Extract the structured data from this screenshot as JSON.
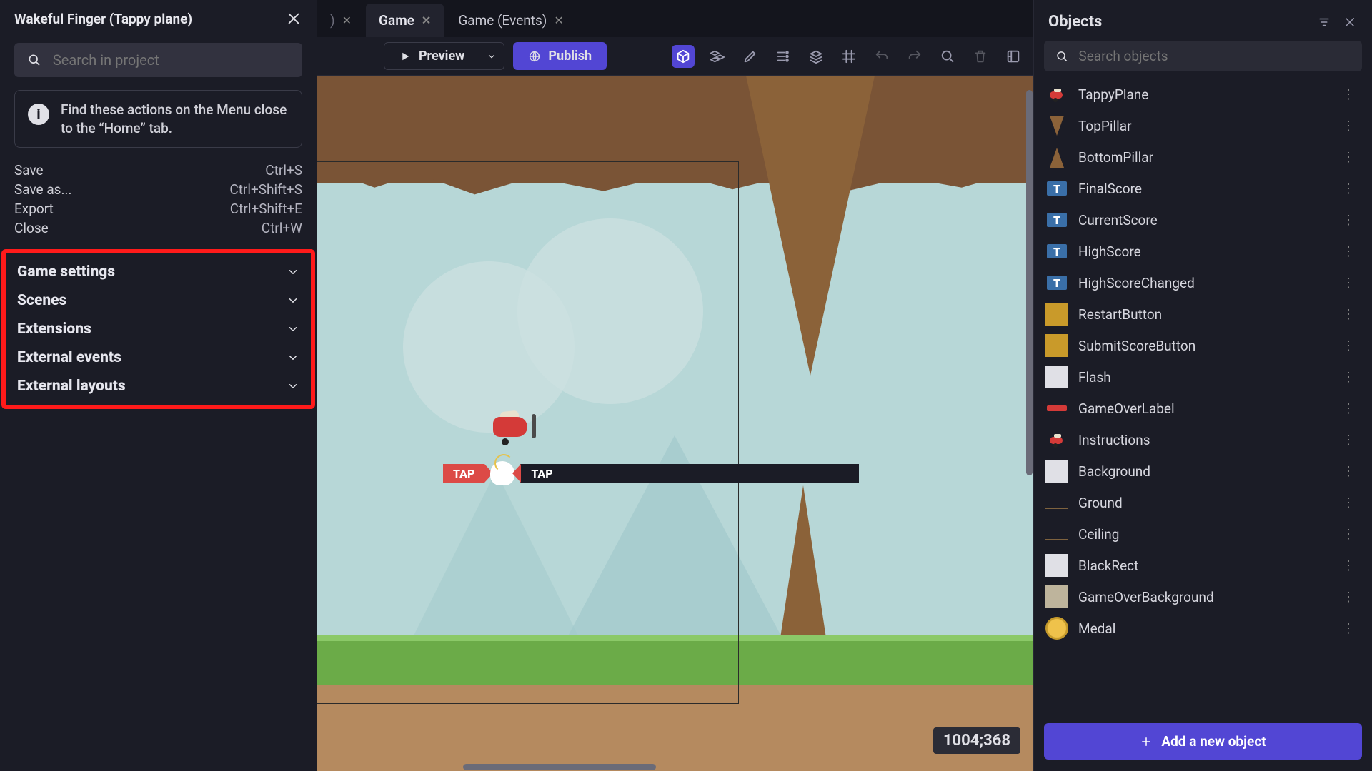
{
  "sidebar": {
    "title": "Wakeful Finger (Tappy plane)",
    "search_placeholder": "Search in project",
    "tip_text": "Find these actions on the Menu close to the “Home” tab.",
    "actions": [
      {
        "label": "Save",
        "shortcut": "Ctrl+S"
      },
      {
        "label": "Save as...",
        "shortcut": "Ctrl+Shift+S"
      },
      {
        "label": "Export",
        "shortcut": "Ctrl+Shift+E"
      },
      {
        "label": "Close",
        "shortcut": "Ctrl+W"
      }
    ],
    "sections": [
      {
        "label": "Game settings"
      },
      {
        "label": "Scenes"
      },
      {
        "label": "Extensions"
      },
      {
        "label": "External events"
      },
      {
        "label": "External layouts"
      }
    ]
  },
  "tabs": [
    {
      "label": ")",
      "active": false,
      "closable": true,
      "dim": true
    },
    {
      "label": "Game",
      "active": true,
      "closable": true
    },
    {
      "label": "Game (Events)",
      "active": false,
      "closable": true
    }
  ],
  "toolbar": {
    "preview_label": "Preview",
    "publish_label": "Publish"
  },
  "viewport": {
    "coord_text": "1004;368",
    "tap_label": "TAP"
  },
  "objects_panel": {
    "title": "Objects",
    "search_placeholder": "Search objects",
    "add_label": "Add a new object",
    "items": [
      {
        "name": "TappyPlane",
        "thumb": "plane"
      },
      {
        "name": "TopPillar",
        "thumb": "tri-down"
      },
      {
        "name": "BottomPillar",
        "thumb": "tri-up"
      },
      {
        "name": "FinalScore",
        "thumb": "textblock"
      },
      {
        "name": "CurrentScore",
        "thumb": "textblock"
      },
      {
        "name": "HighScore",
        "thumb": "textblock"
      },
      {
        "name": "HighScoreChanged",
        "thumb": "textblock"
      },
      {
        "name": "RestartButton",
        "thumb": "yellow"
      },
      {
        "name": "SubmitScoreButton",
        "thumb": "yellow"
      },
      {
        "name": "Flash",
        "thumb": "square"
      },
      {
        "name": "GameOverLabel",
        "thumb": "textlabel"
      },
      {
        "name": "Instructions",
        "thumb": "plane"
      },
      {
        "name": "Background",
        "thumb": "square"
      },
      {
        "name": "Ground",
        "thumb": "line"
      },
      {
        "name": "Ceiling",
        "thumb": "line"
      },
      {
        "name": "BlackRect",
        "thumb": "square"
      },
      {
        "name": "GameOverBackground",
        "thumb": "tan"
      },
      {
        "name": "Medal",
        "thumb": "medal"
      }
    ]
  }
}
